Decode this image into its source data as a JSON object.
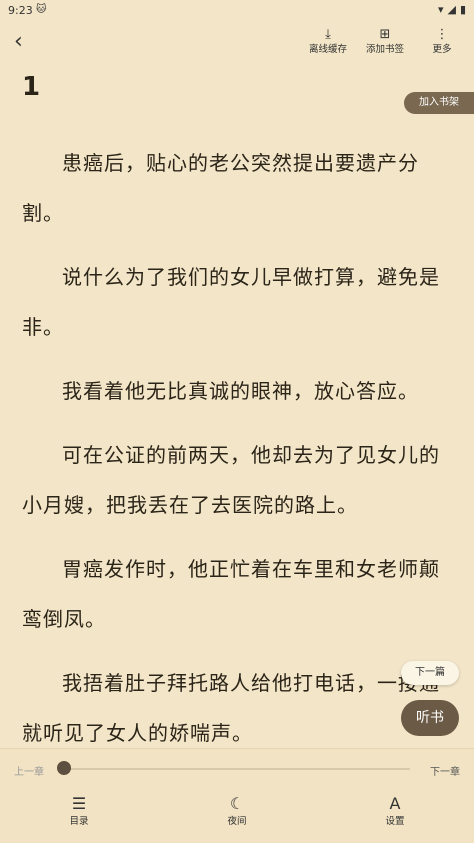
{
  "status": {
    "time": "9:23",
    "app_icon": "cat-icon",
    "icons": [
      "wifi-icon",
      "signal-icon",
      "battery-icon"
    ]
  },
  "topbar": {
    "back_icon": "chevron-left-icon",
    "actions": [
      {
        "label": "离线缓存",
        "icon": "download-icon"
      },
      {
        "label": "添加书签",
        "icon": "bookmark-icon"
      },
      {
        "label": "更多",
        "icon": "more-vertical-icon"
      }
    ]
  },
  "chapter": {
    "title": "1",
    "add_to_shelf": "加入书架",
    "paragraphs": [
      "患癌后，贴心的老公突然提出要遗产分割。",
      "说什么为了我们的女儿早做打算，避免是非。",
      "我看着他无比真诚的眼神，放心答应。",
      "可在公证的前两天，他却去为了见女儿的小月嫂，把我丢在了去医院的路上。",
      "胃癌发作时，他正忙着在车里和女老师颠鸾倒凤。",
      "我捂着肚子拜托路人给他打电话，一接通就听见了女人的娇喘声。"
    ]
  },
  "floating": {
    "next_article": "下一篇",
    "listen": "听书"
  },
  "bottom": {
    "prev_chapter": "上一章",
    "next_chapter": "下一章",
    "progress": 0.0,
    "nav": [
      {
        "label": "目录",
        "icon": "list-icon"
      },
      {
        "label": "夜间",
        "icon": "moon-icon"
      },
      {
        "label": "设置",
        "icon": "font-icon"
      }
    ]
  },
  "colors": {
    "page_bg": "#f3e6c8",
    "accent": "#6b5a45"
  }
}
